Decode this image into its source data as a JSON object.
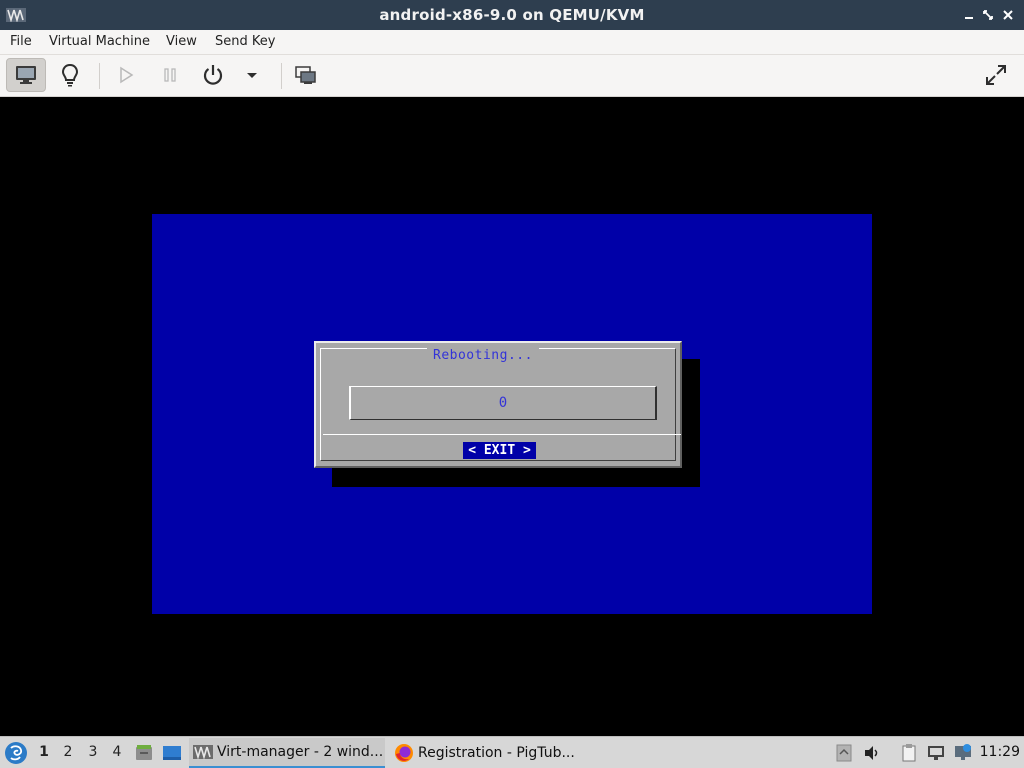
{
  "window": {
    "title": "android-x86-9.0 on QEMU/KVM"
  },
  "menu": {
    "file": "File",
    "virtual_machine": "Virtual Machine",
    "view": "View",
    "send_key": "Send Key"
  },
  "toolbar": {
    "icons": [
      "monitor-icon",
      "lightbulb-icon",
      "play-icon",
      "pause-icon",
      "power-icon",
      "chevron-down-icon",
      "snapshot-icon",
      "fullscreen-icon"
    ]
  },
  "vm": {
    "dialog_title": "Rebooting...",
    "counter_value": "0",
    "exit_label": "< EXIT >",
    "colors": {
      "screen": "#0000a8",
      "dialog": "#a8a8a8",
      "accent_text": "#3333d8"
    }
  },
  "taskbar": {
    "workspaces": [
      "1",
      "2",
      "3",
      "4"
    ],
    "active_workspace": "1",
    "tasks": [
      {
        "label": "Virt-manager - 2 wind...",
        "icon": "virt-manager-icon",
        "active": true
      },
      {
        "label": "Registration - PigTub...",
        "icon": "firefox-icon",
        "active": false
      }
    ],
    "clock": "11:29"
  }
}
